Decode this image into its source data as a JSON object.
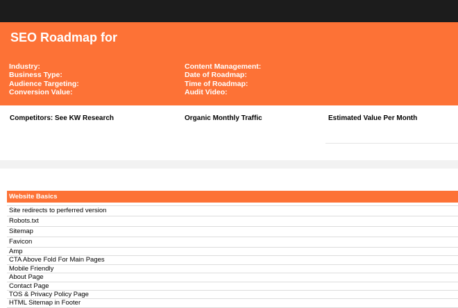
{
  "header": {
    "title": "SEO Roadmap for"
  },
  "info_left": [
    "Industry:",
    "Business Type:",
    "Audience Targeting:",
    "Conversion Value:"
  ],
  "info_right": [
    "Content Management:",
    "Date of Roadmap:",
    "Time of Roadmap:",
    "Audit Video:"
  ],
  "summary": {
    "competitors": "Competitors: See KW Research",
    "traffic": "Organic Monthly Traffic",
    "value": "Estimated Value Per Month"
  },
  "section": {
    "title": "Website Basics",
    "items": [
      "Site redirects to perferred version",
      "Robots.txt",
      "Sitemap",
      "Favicon",
      "Amp",
      "CTA Above Fold For Main Pages",
      "Mobile Friendly",
      "About Page",
      "Contact Page",
      "TOS & Privacy Policy Page",
      "HTML Sitemap in Footer"
    ]
  },
  "colors": {
    "accent": "#fd7236",
    "topbar": "#1c1c1c",
    "grid_line": "#dcdcdc"
  }
}
